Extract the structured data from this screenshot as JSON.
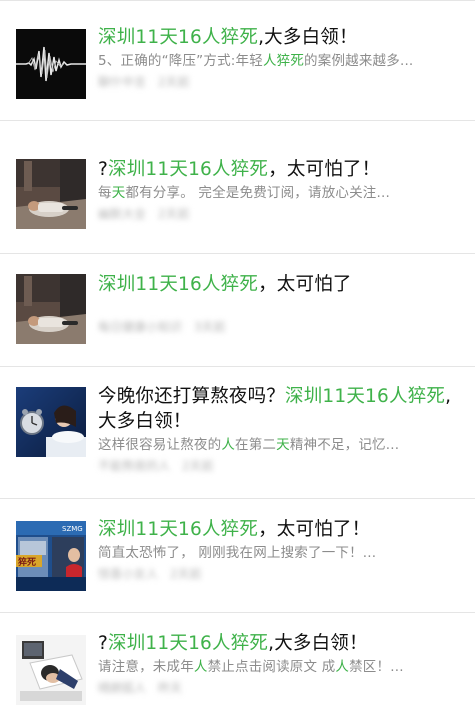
{
  "results": [
    {
      "title_parts": [
        {
          "text": "深圳11天16人猝死",
          "hl": true
        },
        {
          "text": ",大多白领！",
          "hl": false
        }
      ],
      "desc_parts": [
        {
          "text": "5、正确的“降压”方式:年轻",
          "hl": false
        },
        {
          "text": "人猝死",
          "hl": true
        },
        {
          "text": "的案例越来越多...",
          "hl": false
        }
      ],
      "meta": [
        "聊什中言",
        "2天前"
      ],
      "thumb": "heartbeat-waveform-icon"
    },
    {
      "title_parts": [
        {
          "text": "?",
          "hl": false
        },
        {
          "text": "深圳11天16人猝死",
          "hl": true
        },
        {
          "text": "，太可怕了！",
          "hl": false
        }
      ],
      "desc_parts": [
        {
          "text": "每",
          "hl": false
        },
        {
          "text": "天",
          "hl": true
        },
        {
          "text": "都有分享。 完全是免费订阅，请放心关注...",
          "hl": false
        }
      ],
      "meta": [
        "幽默大全",
        "2天前"
      ],
      "thumb": "collapsed-person-photo"
    },
    {
      "title_parts": [
        {
          "text": "深圳11天16人猝死",
          "hl": true
        },
        {
          "text": "，太可怕了",
          "hl": false
        }
      ],
      "desc_parts": [],
      "meta": [
        "每日健康小知识",
        "3天前"
      ],
      "thumb": "collapsed-person-photo"
    },
    {
      "title_parts": [
        {
          "text": "今晚你还打算熬夜吗？",
          "hl": false
        },
        {
          "text": "深圳11天16人猝死",
          "hl": true
        },
        {
          "text": ",大多白领！",
          "hl": false
        }
      ],
      "desc_parts": [
        {
          "text": "这样很容易让熬夜的",
          "hl": false
        },
        {
          "text": "人",
          "hl": true
        },
        {
          "text": "在第二",
          "hl": false
        },
        {
          "text": "天",
          "hl": true
        },
        {
          "text": "精神不足，记忆...",
          "hl": false
        }
      ],
      "meta": [
        "不能熬夜的人",
        "2天前"
      ],
      "thumb": "sleeping-woman-alarm-clock-photo"
    },
    {
      "title_parts": [
        {
          "text": "深圳11天16人猝死",
          "hl": true
        },
        {
          "text": "，太可怕了！",
          "hl": false
        }
      ],
      "desc_parts": [
        {
          "text": "简直太恐怖了， 刚刚我在网上搜索了一下！...",
          "hl": false
        }
      ],
      "meta": [
        "惊喜小女人",
        "2天前"
      ],
      "thumb": "sztv-news-broadcast-photo"
    },
    {
      "title_parts": [
        {
          "text": "?",
          "hl": false
        },
        {
          "text": "深圳11天16人猝死",
          "hl": true
        },
        {
          "text": ",大多白领！",
          "hl": false
        }
      ],
      "desc_parts": [
        {
          "text": "请注意，未成年",
          "hl": false
        },
        {
          "text": "人",
          "hl": true
        },
        {
          "text": "禁止点击阅读原文 成",
          "hl": false
        },
        {
          "text": "人",
          "hl": true
        },
        {
          "text": "禁区！...",
          "hl": false
        }
      ],
      "meta": [
        "晴朗狐人",
        "昨天"
      ],
      "thumb": "exhausted-office-worker-photo"
    }
  ],
  "thumb_badge_text": "SZMG",
  "thumb_caption_text": "猝死"
}
